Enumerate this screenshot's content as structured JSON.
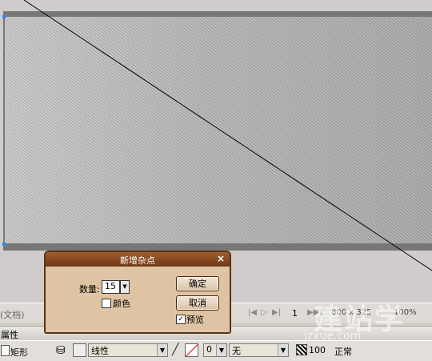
{
  "status_bar": {
    "document_label": "(文档)",
    "nav_first": "|◀",
    "nav_prev": "▷",
    "nav_next": "▶|",
    "nav_last": "▶▶|",
    "page_number": "1",
    "canvas_size": "800 x 325",
    "zoom": "100%"
  },
  "properties": {
    "panel_title": "属性",
    "shape_name": "矩形",
    "fill_type": "线性",
    "stroke_width": "0",
    "stroke_style": "无",
    "opacity": "100",
    "blend_mode": "正常"
  },
  "dialog": {
    "title": "新增杂点",
    "close": "×",
    "quantity_label": "数量:",
    "quantity_value": "15",
    "color_label": "颜色",
    "color_checked": "",
    "ok_label": "确定",
    "cancel_label": "取消",
    "preview_label": "预览",
    "preview_checked": "✓"
  },
  "watermark": {
    "text": "建站学",
    "sub": "jzxue.com"
  },
  "colors": {
    "selection_handle": "#2b8bf0",
    "dialog_title": "#7a4019",
    "dialog_body": "#dfc4a4"
  }
}
